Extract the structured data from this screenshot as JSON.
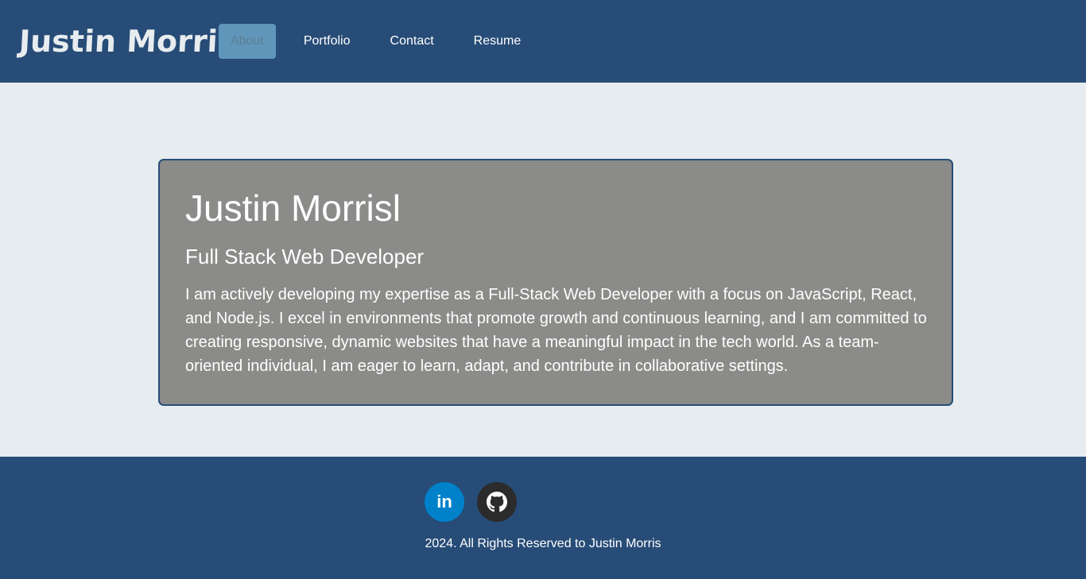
{
  "header": {
    "brand": "Justin Morris",
    "nav": [
      {
        "label": "About",
        "active": true
      },
      {
        "label": "Portfolio",
        "active": false
      },
      {
        "label": "Contact",
        "active": false
      },
      {
        "label": "Resume",
        "active": false
      }
    ]
  },
  "about": {
    "title": "Justin Morrisl",
    "subtitle": "Full Stack Web Developer",
    "body": "I am actively developing my expertise as a Full-Stack Web Developer with a focus on JavaScript, React, and Node.js. I excel in environments that promote growth and continuous learning, and I am committed to creating responsive, dynamic websites that have a meaningful impact in the tech world. As a team-oriented individual, I am eager to learn, adapt, and contribute in collaborative settings."
  },
  "footer": {
    "social": [
      {
        "icon": "linkedin-icon",
        "color": "#0082ca"
      },
      {
        "icon": "github-icon",
        "color": "#2b2b2b"
      }
    ],
    "copyright": "2024. All Rights Reserved to Justin Morris"
  },
  "colors": {
    "primary": "#274c77",
    "accent": "#6096ba",
    "background": "#e6ecef",
    "card": "#8b8b89"
  }
}
